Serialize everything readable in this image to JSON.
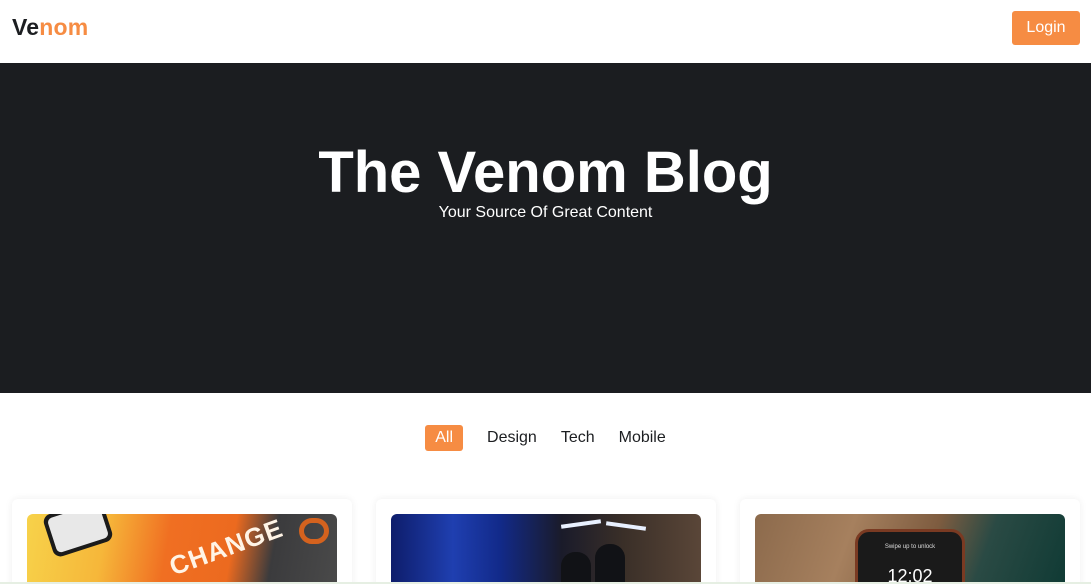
{
  "header": {
    "logo_part1": "Ve",
    "logo_part2": "nom",
    "login_label": "Login"
  },
  "hero": {
    "title": "The Venom Blog",
    "subtitle": "Your Source Of Great Content"
  },
  "filters": [
    {
      "label": "All",
      "active": true
    },
    {
      "label": "Design",
      "active": false
    },
    {
      "label": "Tech",
      "active": false
    },
    {
      "label": "Mobile",
      "active": false
    }
  ],
  "cards": [
    {
      "image_text": "CHANGE"
    },
    {
      "image_text": ""
    },
    {
      "image_text": "12:02",
      "image_subtext": "Swipe up to unlock"
    }
  ],
  "colors": {
    "accent": "#f68c43",
    "hero_bg": "#1b1d20",
    "text_dark": "#1c1e21"
  }
}
